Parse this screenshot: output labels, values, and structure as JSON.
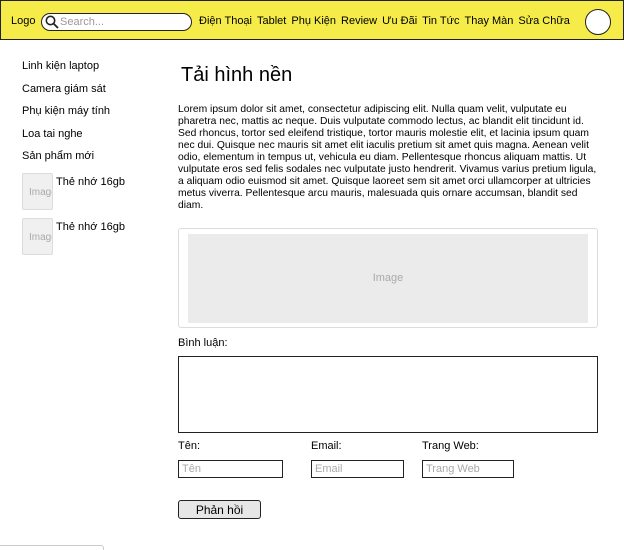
{
  "header": {
    "logo": "Logo",
    "search_placeholder": "Search...",
    "nav": [
      "Điện Thoại",
      "Tablet",
      "Phụ Kiện",
      "Review",
      "Ưu Đãi",
      "Tin Tức",
      "Thay Màn",
      "Sửa Chữa"
    ]
  },
  "sidebar": {
    "links": [
      "Linh kiện laptop",
      "Camera giám sát",
      "Phụ kiện máy tính",
      "Loa tai nghe",
      "Sản phẩm mới"
    ],
    "products": [
      {
        "thumb": "Image",
        "name": "Thẻ nhớ 16gb"
      },
      {
        "thumb": "Image",
        "name": "Thẻ nhớ 16gb"
      }
    ]
  },
  "main": {
    "title": "Tải hình nền",
    "body": "Lorem ipsum dolor sit amet, consectetur adipiscing elit. Nulla quam velit, vulputate eu pharetra nec, mattis ac neque. Duis vulputate commodo lectus, ac blandit elit tincidunt id. Sed rhoncus, tortor sed eleifend tristique, tortor mauris molestie elit, et lacinia ipsum quam nec dui. Quisque nec mauris sit amet elit iaculis pretium sit amet quis magna. Aenean velit odio, elementum in tempus ut, vehicula eu diam. Pellentesque rhoncus aliquam mattis. Ut vulputate eros sed felis sodales nec vulputate justo hendrerit. Vivamus varius pretium ligula, a aliquam odio euismod sit amet. Quisque laoreet sem sit amet orci ullamcorper at ultricies metus viverra. Pellentesque arcu mauris, malesuada quis ornare accumsan, blandit sed diam.",
    "image_label": "Image"
  },
  "form": {
    "comment_label": "Bình luận:",
    "name_label": "Tên:",
    "name_placeholder": "Tên",
    "email_label": "Email:",
    "email_placeholder": "Email",
    "website_label": "Trang Web:",
    "website_placeholder": "Trang Web",
    "submit_label": "Phản hồi"
  }
}
